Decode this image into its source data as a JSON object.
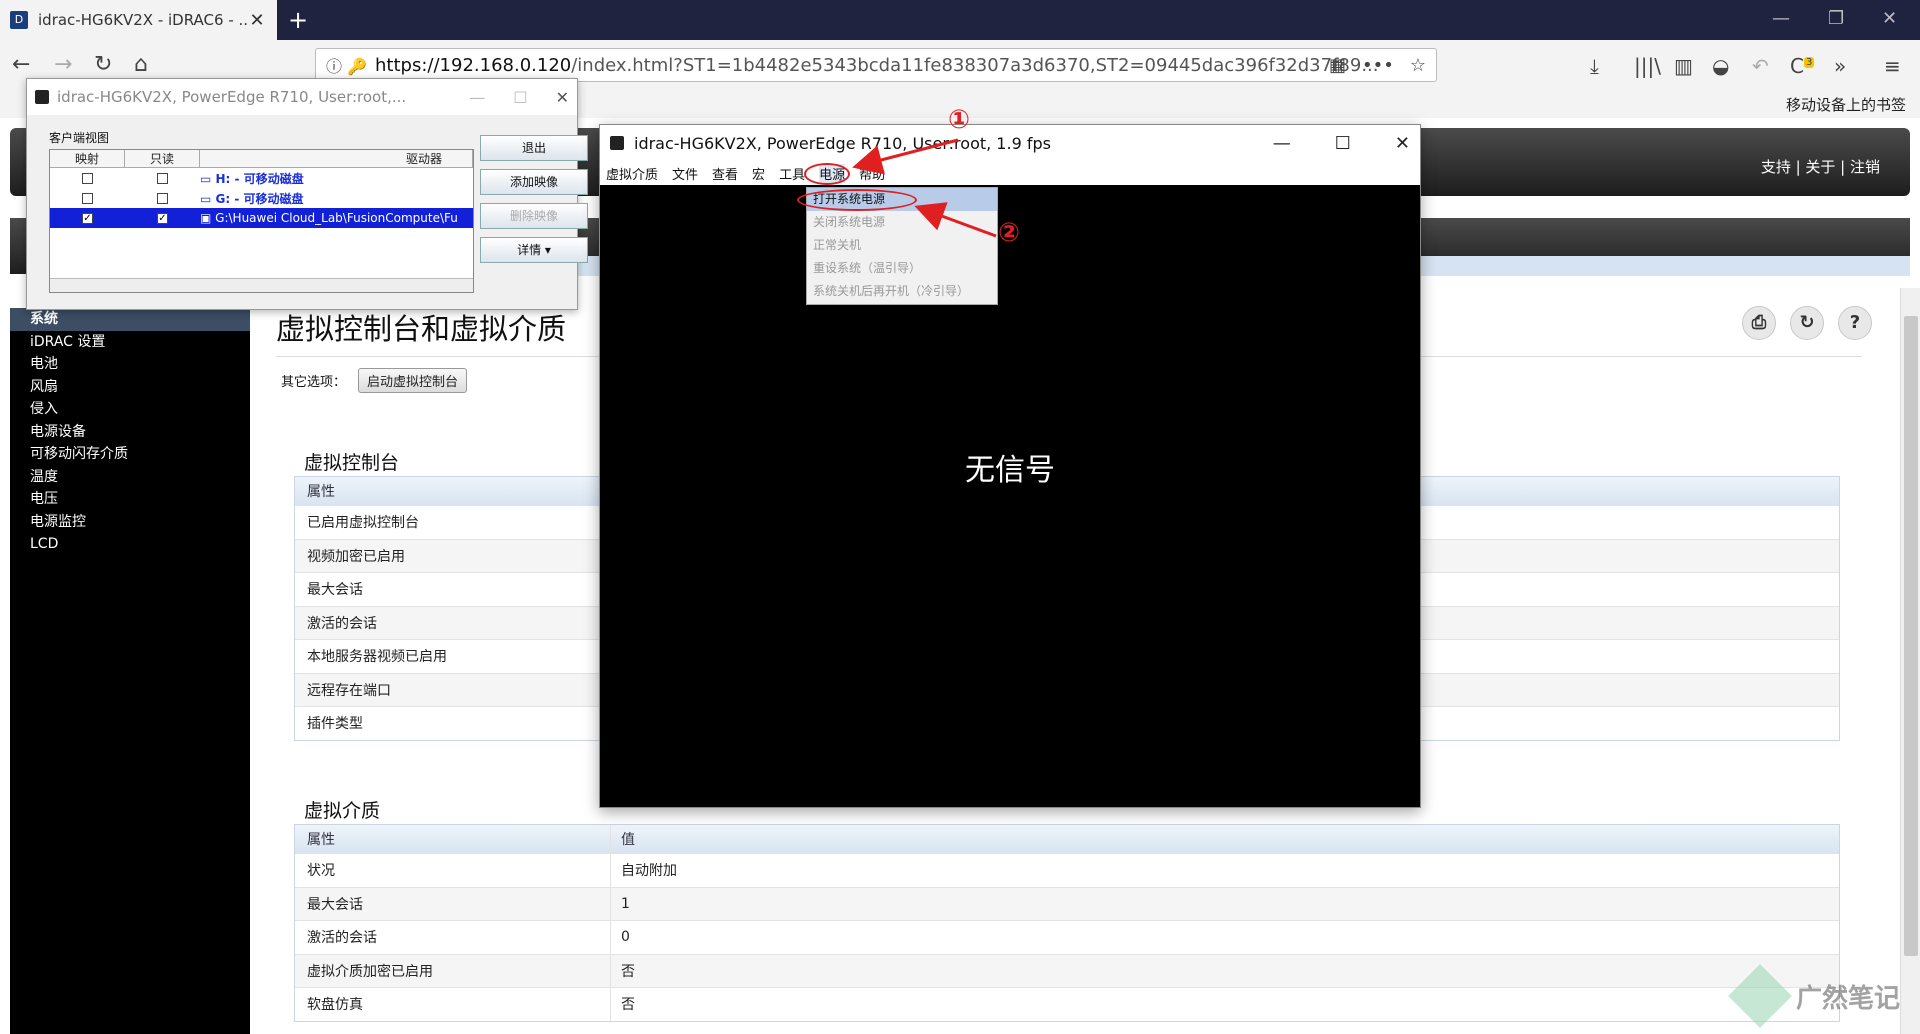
{
  "browser": {
    "tab_title": "idrac-HG6KV2X - iDRAC6 - ...",
    "url_host": "https://192.168.0.120",
    "url_path": "/index.html?ST1=1b4482e5343bcda11fe838307a3d6370,ST2=09445dac396f32d37f89...",
    "mobile_bookmarks": "移动设备上的书签",
    "badge_count": "3"
  },
  "header": {
    "links": "支持  |  关于  |  注销"
  },
  "sidebar": {
    "items": [
      {
        "label": "系统"
      },
      {
        "label": "iDRAC 设置"
      },
      {
        "label": "电池"
      },
      {
        "label": "风扇"
      },
      {
        "label": "侵入"
      },
      {
        "label": "电源设备"
      },
      {
        "label": "可移动闪存介质"
      },
      {
        "label": "温度"
      },
      {
        "label": "电压"
      },
      {
        "label": "电源监控"
      },
      {
        "label": "LCD"
      }
    ]
  },
  "main": {
    "title": "虚拟控制台和虚拟介质",
    "other_options_label": "其它选项：",
    "launch_console_button": "启动虚拟控制台",
    "console_section": {
      "title": "虚拟控制台",
      "header": "属性",
      "rows": [
        "已启用虚拟控制台",
        "视频加密已启用",
        "最大会话",
        "激活的会话",
        "本地服务器视频已启用",
        "远程存在端口",
        "插件类型"
      ]
    },
    "media_section": {
      "title": "虚拟介质",
      "header_col1": "属性",
      "header_col2": "值",
      "rows": [
        {
          "k": "状况",
          "v": "自动附加"
        },
        {
          "k": "最大会话",
          "v": "1"
        },
        {
          "k": "激活的会话",
          "v": "0"
        },
        {
          "k": "虚拟介质加密已启用",
          "v": "否"
        },
        {
          "k": "软盘仿真",
          "v": "否"
        }
      ]
    }
  },
  "client_dialog": {
    "title": "idrac-HG6KV2X, PowerEdge R710, User:root,...",
    "section_label": "客户端视图",
    "col_map": "映射",
    "col_readonly": "只读",
    "col_drive": "驱动器",
    "drives": [
      {
        "label": "H: - 可移动磁盘",
        "mapped": false,
        "readonly": false,
        "selected": false
      },
      {
        "label": "G: - 可移动磁盘",
        "mapped": false,
        "readonly": false,
        "selected": false
      },
      {
        "label": "G:\\Huawei Cloud_Lab\\FusionCompute\\Fu",
        "mapped": true,
        "readonly": true,
        "selected": true
      }
    ],
    "btn_exit": "退出",
    "btn_add": "添加映像",
    "btn_remove": "删除映像",
    "btn_details": "详情 ▾"
  },
  "console": {
    "title": "idrac-HG6KV2X, PowerEdge R710, User:root, 1.9 fps",
    "menu": [
      "虚拟介质",
      "文件",
      "查看",
      "宏",
      "工具",
      "电源",
      "帮助"
    ],
    "no_signal": "无信号",
    "power_menu": [
      "打开系统电源",
      "关闭系统电源",
      "正常关机",
      "重设系统（温引导）",
      "系统关机后再开机（冷引导）"
    ]
  },
  "annotations": {
    "step1": "①",
    "step2": "②"
  },
  "watermark": "广然笔记",
  "colors": {
    "annotation_red": "#e02020",
    "selection_blue": "#1221d8",
    "sidebar_bg": "#000000"
  }
}
